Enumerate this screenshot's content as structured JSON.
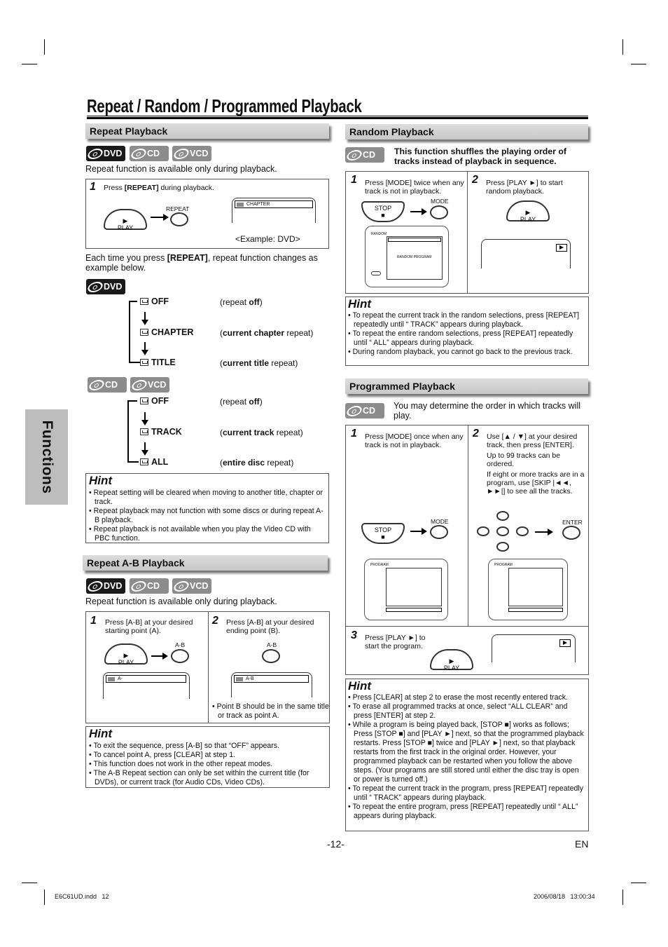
{
  "page": {
    "title": "Repeat / Random / Programmed Playback",
    "side_tab": "Functions",
    "page_number": "-12-",
    "language": "EN",
    "footer_file": "E6C61UD.indd   12",
    "footer_timestamp": "2006/08/18   13:00:34"
  },
  "badges": {
    "dvd": "DVD",
    "cd": "CD",
    "vcd": "VCD"
  },
  "repeat": {
    "heading": "Repeat Playback",
    "availability": "Repeat function is available only during playback.",
    "step1_num": "1",
    "step1_pre": "Press ",
    "step1_key": "[REPEAT]",
    "step1_post": " during playback.",
    "btn_play": "PLAY",
    "btn_repeat": "REPEAT",
    "osd_chapter": "CHAPTER",
    "example": "<Example: DVD>",
    "each_time_pre": "Each time you press ",
    "each_time_key": "[REPEAT]",
    "each_time_post": ", repeat function changes as example below.",
    "dvd_modes": [
      {
        "label": "OFF",
        "desc_pre": "(repeat ",
        "desc_bold": "off",
        "desc_post": ")"
      },
      {
        "label": "CHAPTER",
        "desc_pre": "(",
        "desc_bold": "current chapter",
        "desc_post": " repeat)"
      },
      {
        "label": "TITLE",
        "desc_pre": "(",
        "desc_bold": "current title",
        "desc_post": " repeat)"
      }
    ],
    "cd_modes": [
      {
        "label": "OFF",
        "desc_pre": "(repeat ",
        "desc_bold": "off",
        "desc_post": ")"
      },
      {
        "label": "TRACK",
        "desc_pre": "(",
        "desc_bold": "current track",
        "desc_post": " repeat)"
      },
      {
        "label": "ALL",
        "desc_pre": "(",
        "desc_bold": "entire disc",
        "desc_post": " repeat)"
      }
    ],
    "hint_title": "Hint",
    "hints": [
      "Repeat setting will be cleared when moving to another title, chapter or track.",
      "Repeat playback may not function with some discs or during repeat A-B playback.",
      "Repeat playback is not available when you play the Video CD with PBC function."
    ]
  },
  "ab": {
    "heading": "Repeat A-B Playback",
    "availability": "Repeat function is available only during playback.",
    "step1_num": "1",
    "step1_text": "Press [A-B] at your desired starting point (A).",
    "step2_num": "2",
    "step2_text": "Press [A-B] at your desired ending point (B).",
    "btn_play": "PLAY",
    "btn_ab": "A-B",
    "osd_a": "A-",
    "osd_ab": "A-B",
    "note": "Point B should be in the same title or track as point A.",
    "hint_title": "Hint",
    "hints": [
      "To exit the sequence, press [A-B] so that “OFF” appears.",
      "To cancel point A, press [CLEAR] at step 1.",
      "This function does not work in the other repeat modes.",
      "The A-B Repeat section can only be set within the current title (for DVDs), or current track (for Audio CDs, Video CDs)."
    ]
  },
  "random": {
    "heading": "Random Playback",
    "intro": "This function shuffles the playing order of tracks instead of playback in sequence.",
    "step1_num": "1",
    "step1_text": "Press [MODE] twice when any track is not in playback.",
    "step2_num": "2",
    "step2_text": "Press [PLAY ►] to start random playback.",
    "btn_stop": "STOP",
    "btn_mode": "MODE",
    "btn_play": "PLAY",
    "osd_title": "RANDOM",
    "osd_program": "RANDOM PROGRAM",
    "hint_title": "Hint",
    "hints": [
      "To repeat the current track in the random selections, press [REPEAT] repeatedly until “ TRACK” appears during playback.",
      "To repeat the entire random selections, press [REPEAT] repeatedly until “ ALL” appears during playback.",
      "During random playback, you cannot go back to the previous track."
    ]
  },
  "program": {
    "heading": "Programmed Playback",
    "intro": "You may determine the order in which tracks will play.",
    "step1_num": "1",
    "step1_text": "Press [MODE] once when any track is not in playback.",
    "step2_num": "2",
    "step2_text": "Use [▲ / ▼] at your desired track, then press [ENTER].",
    "step2_note1": "Up to 99 tracks can be ordered.",
    "step2_note2": "If eight or more tracks are in a program, use [SKIP |◄◄, ►►|] to see all the tracks.",
    "step3_num": "3",
    "step3_text": "Press [PLAY ►] to start the program.",
    "btn_stop": "STOP",
    "btn_mode": "MODE",
    "btn_enter": "ENTER",
    "btn_play": "PLAY",
    "osd_title": "PROGRAM",
    "hint_title": "Hint",
    "hints": [
      "Press [CLEAR] at step 2 to erase the most recently entered track.",
      "To erase all programmed tracks at once, select “ALL CLEAR” and press [ENTER] at step 2.",
      "While a program is being played back, [STOP ■] works as follows; Press [STOP ■] and [PLAY ►] next, so that the programmed playback restarts. Press [STOP ■] twice and [PLAY ►] next, so that playback restarts from the first track in the original order. However, your programmed playback can be restarted when you follow the above steps. (Your programs are still stored until either the disc tray is open or power is turned off.)",
      "To repeat the current track in the program, press [REPEAT] repeatedly until “ TRACK” appears during playback.",
      "To repeat the entire program, press [REPEAT] repeatedly until “ ALL” appears during playback."
    ]
  }
}
